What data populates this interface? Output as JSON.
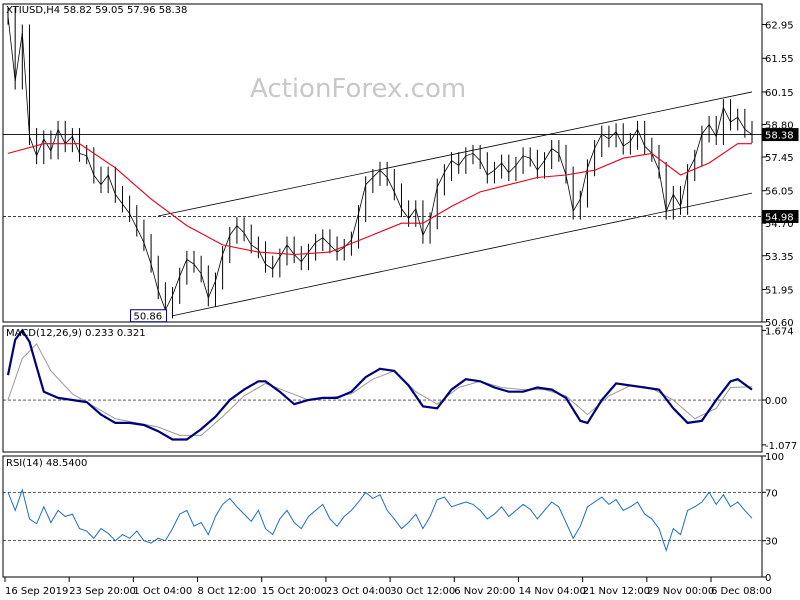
{
  "chart_data": {
    "type": "line",
    "watermark": "ActionForex.com",
    "x_labels": [
      "16 Sep 2019",
      "23 Sep 20:00",
      "1 Oct 04:00",
      "8 Oct 12:00",
      "15 Oct 20:00",
      "23 Oct 04:00",
      "30 Oct 12:00",
      "6 Nov 20:00",
      "14 Nov 04:00",
      "21 Nov 12:00",
      "29 Nov 00:00",
      "6 Dec 08:00"
    ],
    "price_panel": {
      "header": "XTIUSD,H4  58.82 59.05 57.96 58.38",
      "ylim": [
        50.6,
        63.8
      ],
      "ticks": [
        62.95,
        61.55,
        60.15,
        58.8,
        57.45,
        56.05,
        54.7,
        53.35,
        51.95,
        50.6
      ],
      "tick_labels": [
        "62.95",
        "61.55",
        "60.15",
        "58.80",
        "57.45",
        "56.05",
        "54.70",
        "53.35",
        "51.95",
        "50.60"
      ],
      "price_tag": "58.38",
      "price_level": 58.38,
      "support_tag": "54.98",
      "support_level": 54.98,
      "low_tag": "50.86",
      "low_level": 50.86,
      "price_series": [
        [
          0,
          63.3
        ],
        [
          1,
          60.6
        ],
        [
          2,
          62.6
        ],
        [
          3,
          58.3
        ],
        [
          4,
          57.5
        ],
        [
          5,
          58.2
        ],
        [
          6,
          57.7
        ],
        [
          7,
          58.6
        ],
        [
          8,
          58.0
        ],
        [
          9,
          58.3
        ],
        [
          10,
          57.6
        ],
        [
          11,
          57.5
        ],
        [
          12,
          56.7
        ],
        [
          13,
          56.3
        ],
        [
          14,
          56.7
        ],
        [
          15,
          55.9
        ],
        [
          16,
          55.5
        ],
        [
          17,
          55.1
        ],
        [
          18,
          54.5
        ],
        [
          19,
          53.9
        ],
        [
          20,
          53.0
        ],
        [
          21,
          51.9
        ],
        [
          22,
          51.1
        ],
        [
          23,
          51.7
        ],
        [
          24,
          52.5
        ],
        [
          25,
          53.2
        ],
        [
          26,
          53.0
        ],
        [
          27,
          52.6
        ],
        [
          28,
          51.6
        ],
        [
          29,
          52.3
        ],
        [
          30,
          53.4
        ],
        [
          31,
          54.2
        ],
        [
          32,
          54.6
        ],
        [
          33,
          54.3
        ],
        [
          34,
          53.8
        ],
        [
          35,
          53.6
        ],
        [
          36,
          53.0
        ],
        [
          37,
          52.8
        ],
        [
          38,
          53.3
        ],
        [
          39,
          53.8
        ],
        [
          40,
          53.4
        ],
        [
          41,
          53.1
        ],
        [
          42,
          53.5
        ],
        [
          43,
          53.9
        ],
        [
          44,
          54.1
        ],
        [
          45,
          53.8
        ],
        [
          46,
          53.5
        ],
        [
          47,
          53.7
        ],
        [
          48,
          54.0
        ],
        [
          49,
          55.1
        ],
        [
          50,
          56.3
        ],
        [
          51,
          56.6
        ],
        [
          52,
          56.9
        ],
        [
          53,
          56.6
        ],
        [
          54,
          56.0
        ],
        [
          55,
          55.3
        ],
        [
          56,
          54.9
        ],
        [
          57,
          55.3
        ],
        [
          58,
          54.2
        ],
        [
          59,
          54.8
        ],
        [
          60,
          56.2
        ],
        [
          61,
          56.8
        ],
        [
          62,
          57.3
        ],
        [
          63,
          57.1
        ],
        [
          64,
          57.5
        ],
        [
          65,
          57.6
        ],
        [
          66,
          57.3
        ],
        [
          67,
          56.7
        ],
        [
          68,
          56.9
        ],
        [
          69,
          57.2
        ],
        [
          70,
          56.8
        ],
        [
          71,
          57.1
        ],
        [
          72,
          57.5
        ],
        [
          73,
          57.4
        ],
        [
          74,
          56.9
        ],
        [
          75,
          57.3
        ],
        [
          76,
          57.8
        ],
        [
          77,
          57.6
        ],
        [
          78,
          56.7
        ],
        [
          79,
          55.2
        ],
        [
          80,
          55.7
        ],
        [
          81,
          57.0
        ],
        [
          82,
          57.8
        ],
        [
          83,
          58.4
        ],
        [
          84,
          58.2
        ],
        [
          85,
          58.5
        ],
        [
          86,
          57.9
        ],
        [
          87,
          58.1
        ],
        [
          88,
          58.6
        ],
        [
          89,
          57.9
        ],
        [
          90,
          57.6
        ],
        [
          91,
          56.9
        ],
        [
          92,
          55.2
        ],
        [
          93,
          55.9
        ],
        [
          94,
          55.4
        ],
        [
          95,
          56.8
        ],
        [
          96,
          57.4
        ],
        [
          97,
          58.4
        ],
        [
          98,
          58.8
        ],
        [
          99,
          58.3
        ],
        [
          100,
          59.5
        ],
        [
          101,
          58.9
        ],
        [
          102,
          59.1
        ],
        [
          103,
          58.6
        ],
        [
          104,
          58.38
        ]
      ],
      "ma_series": [
        [
          0,
          57.6
        ],
        [
          5,
          58.0
        ],
        [
          10,
          58.0
        ],
        [
          15,
          57.0
        ],
        [
          20,
          55.7
        ],
        [
          25,
          54.6
        ],
        [
          30,
          53.8
        ],
        [
          35,
          53.5
        ],
        [
          40,
          53.4
        ],
        [
          45,
          53.5
        ],
        [
          50,
          54.1
        ],
        [
          55,
          54.7
        ],
        [
          58,
          54.7
        ],
        [
          62,
          55.4
        ],
        [
          66,
          56.0
        ],
        [
          70,
          56.3
        ],
        [
          74,
          56.6
        ],
        [
          78,
          56.7
        ],
        [
          82,
          56.9
        ],
        [
          86,
          57.4
        ],
        [
          90,
          57.6
        ],
        [
          94,
          56.7
        ],
        [
          98,
          57.2
        ],
        [
          102,
          58.0
        ],
        [
          104,
          58.0
        ]
      ],
      "channel_upper": [
        [
          21,
          55.0
        ],
        [
          104,
          60.15
        ]
      ],
      "channel_lower": [
        [
          23,
          50.86
        ],
        [
          104,
          55.95
        ]
      ]
    },
    "macd_panel": {
      "header": "MACD(12,26,9) 0.233 0.321",
      "ylim": [
        -1.25,
        1.78
      ],
      "tick_labels": [
        "1.674",
        "0.00",
        "-1.077"
      ],
      "tick_values": [
        1.674,
        0.0,
        -1.077
      ],
      "macd_series": [
        [
          0,
          0.6
        ],
        [
          1,
          1.45
        ],
        [
          2,
          1.674
        ],
        [
          3,
          1.4
        ],
        [
          4,
          0.8
        ],
        [
          5,
          0.2
        ],
        [
          7,
          0.05
        ],
        [
          9,
          0.0
        ],
        [
          11,
          -0.05
        ],
        [
          13,
          -0.35
        ],
        [
          15,
          -0.55
        ],
        [
          17,
          -0.55
        ],
        [
          19,
          -0.6
        ],
        [
          21,
          -0.75
        ],
        [
          23,
          -0.95
        ],
        [
          25,
          -0.95
        ],
        [
          27,
          -0.7
        ],
        [
          29,
          -0.4
        ],
        [
          31,
          0.0
        ],
        [
          33,
          0.25
        ],
        [
          35,
          0.45
        ],
        [
          36,
          0.45
        ],
        [
          38,
          0.2
        ],
        [
          40,
          -0.1
        ],
        [
          42,
          0.0
        ],
        [
          44,
          0.05
        ],
        [
          46,
          0.05
        ],
        [
          48,
          0.2
        ],
        [
          50,
          0.55
        ],
        [
          52,
          0.75
        ],
        [
          54,
          0.7
        ],
        [
          56,
          0.35
        ],
        [
          58,
          -0.15
        ],
        [
          60,
          -0.2
        ],
        [
          62,
          0.25
        ],
        [
          64,
          0.5
        ],
        [
          66,
          0.45
        ],
        [
          68,
          0.3
        ],
        [
          70,
          0.2
        ],
        [
          72,
          0.2
        ],
        [
          74,
          0.3
        ],
        [
          76,
          0.25
        ],
        [
          78,
          0.05
        ],
        [
          80,
          -0.5
        ],
        [
          81,
          -0.55
        ],
        [
          83,
          0.0
        ],
        [
          85,
          0.4
        ],
        [
          87,
          0.35
        ],
        [
          89,
          0.3
        ],
        [
          91,
          0.25
        ],
        [
          93,
          -0.2
        ],
        [
          95,
          -0.55
        ],
        [
          97,
          -0.5
        ],
        [
          99,
          0.0
        ],
        [
          101,
          0.45
        ],
        [
          102,
          0.5
        ],
        [
          104,
          0.25
        ]
      ],
      "signal_series": [
        [
          0,
          0.0
        ],
        [
          2,
          1.0
        ],
        [
          4,
          1.35
        ],
        [
          6,
          0.7
        ],
        [
          9,
          0.15
        ],
        [
          12,
          -0.15
        ],
        [
          15,
          -0.45
        ],
        [
          18,
          -0.55
        ],
        [
          21,
          -0.65
        ],
        [
          24,
          -0.85
        ],
        [
          27,
          -0.85
        ],
        [
          30,
          -0.4
        ],
        [
          33,
          0.1
        ],
        [
          36,
          0.4
        ],
        [
          39,
          0.2
        ],
        [
          42,
          0.0
        ],
        [
          45,
          0.05
        ],
        [
          48,
          0.15
        ],
        [
          51,
          0.5
        ],
        [
          54,
          0.7
        ],
        [
          57,
          0.2
        ],
        [
          60,
          -0.1
        ],
        [
          63,
          0.3
        ],
        [
          66,
          0.45
        ],
        [
          69,
          0.3
        ],
        [
          72,
          0.25
        ],
        [
          75,
          0.25
        ],
        [
          78,
          0.1
        ],
        [
          81,
          -0.35
        ],
        [
          84,
          0.1
        ],
        [
          87,
          0.35
        ],
        [
          90,
          0.28
        ],
        [
          93,
          0.0
        ],
        [
          96,
          -0.45
        ],
        [
          99,
          -0.2
        ],
        [
          101,
          0.3
        ],
        [
          104,
          0.32
        ]
      ]
    },
    "rsi_panel": {
      "header": "RSI(14) 48.5400",
      "ylim": [
        0,
        100
      ],
      "tick_labels": [
        "100",
        "70",
        "30",
        "0"
      ],
      "tick_values": [
        100,
        70,
        30,
        0
      ],
      "levels": [
        70,
        30
      ],
      "rsi_series": [
        [
          0,
          70
        ],
        [
          1,
          55
        ],
        [
          2,
          72
        ],
        [
          3,
          48
        ],
        [
          4,
          44
        ],
        [
          5,
          58
        ],
        [
          6,
          45
        ],
        [
          7,
          55
        ],
        [
          8,
          50
        ],
        [
          9,
          52
        ],
        [
          10,
          40
        ],
        [
          11,
          38
        ],
        [
          12,
          32
        ],
        [
          13,
          40
        ],
        [
          14,
          36
        ],
        [
          15,
          30
        ],
        [
          16,
          35
        ],
        [
          17,
          32
        ],
        [
          18,
          38
        ],
        [
          19,
          30
        ],
        [
          20,
          28
        ],
        [
          21,
          32
        ],
        [
          22,
          30
        ],
        [
          23,
          40
        ],
        [
          24,
          52
        ],
        [
          25,
          55
        ],
        [
          26,
          42
        ],
        [
          27,
          45
        ],
        [
          28,
          35
        ],
        [
          29,
          50
        ],
        [
          30,
          60
        ],
        [
          31,
          65
        ],
        [
          32,
          58
        ],
        [
          33,
          52
        ],
        [
          34,
          46
        ],
        [
          35,
          55
        ],
        [
          36,
          40
        ],
        [
          37,
          35
        ],
        [
          38,
          48
        ],
        [
          39,
          55
        ],
        [
          40,
          45
        ],
        [
          41,
          40
        ],
        [
          42,
          50
        ],
        [
          43,
          55
        ],
        [
          44,
          60
        ],
        [
          45,
          48
        ],
        [
          46,
          42
        ],
        [
          47,
          50
        ],
        [
          48,
          55
        ],
        [
          49,
          62
        ],
        [
          50,
          70
        ],
        [
          51,
          65
        ],
        [
          52,
          68
        ],
        [
          53,
          55
        ],
        [
          54,
          48
        ],
        [
          55,
          40
        ],
        [
          56,
          45
        ],
        [
          57,
          52
        ],
        [
          58,
          40
        ],
        [
          59,
          50
        ],
        [
          60,
          64
        ],
        [
          61,
          66
        ],
        [
          62,
          58
        ],
        [
          63,
          60
        ],
        [
          64,
          62
        ],
        [
          65,
          60
        ],
        [
          66,
          55
        ],
        [
          67,
          48
        ],
        [
          68,
          52
        ],
        [
          69,
          58
        ],
        [
          70,
          50
        ],
        [
          71,
          55
        ],
        [
          72,
          60
        ],
        [
          73,
          56
        ],
        [
          74,
          48
        ],
        [
          75,
          55
        ],
        [
          76,
          62
        ],
        [
          77,
          58
        ],
        [
          78,
          45
        ],
        [
          79,
          32
        ],
        [
          80,
          42
        ],
        [
          81,
          58
        ],
        [
          82,
          62
        ],
        [
          83,
          66
        ],
        [
          84,
          60
        ],
        [
          85,
          64
        ],
        [
          86,
          55
        ],
        [
          87,
          58
        ],
        [
          88,
          62
        ],
        [
          89,
          52
        ],
        [
          90,
          48
        ],
        [
          91,
          40
        ],
        [
          92,
          22
        ],
        [
          93,
          40
        ],
        [
          94,
          35
        ],
        [
          95,
          55
        ],
        [
          96,
          58
        ],
        [
          97,
          62
        ],
        [
          98,
          70
        ],
        [
          99,
          60
        ],
        [
          100,
          68
        ],
        [
          101,
          58
        ],
        [
          102,
          62
        ],
        [
          103,
          55
        ],
        [
          104,
          48.54
        ]
      ]
    },
    "colors": {
      "price": "#000000",
      "ma": "#e8001c",
      "macd": "#00007a",
      "signal": "#9a9a9a",
      "rsi": "#1e6ec8",
      "grid": "#000000"
    }
  }
}
